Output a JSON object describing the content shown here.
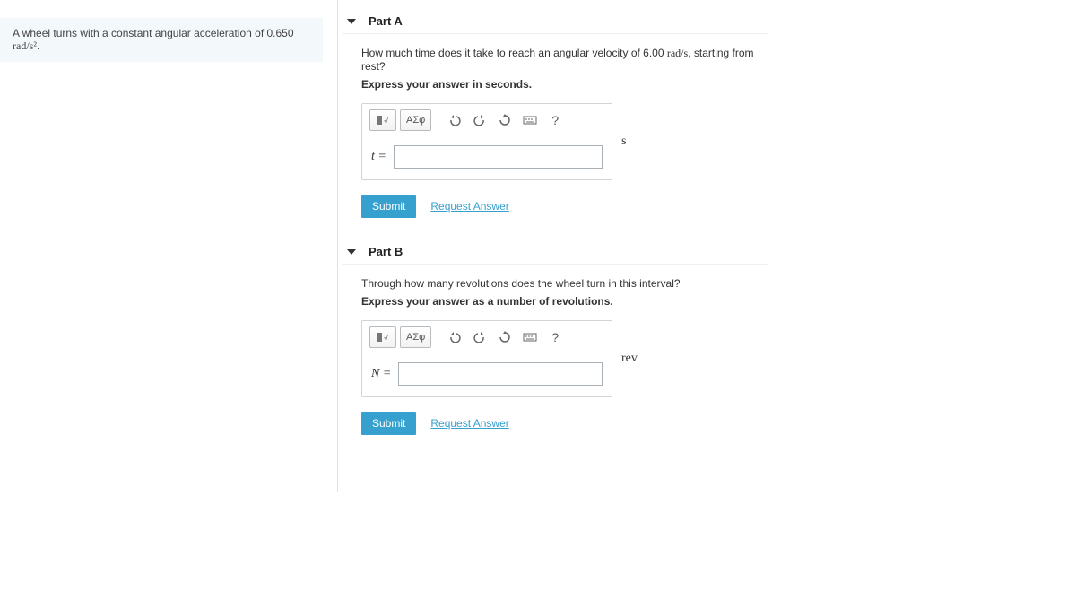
{
  "problem": {
    "text_pre": "A wheel turns with a constant angular acceleration of 0.650 ",
    "unit_html": "rad/s²",
    "text_post": "."
  },
  "parts": [
    {
      "title": "Part A",
      "question_pre": "How much time does it take to reach an angular velocity of 6.00 ",
      "question_unit": "rad/s",
      "question_post": ", starting from rest?",
      "instruction": "Express your answer in seconds.",
      "toolbar": {
        "symbols_label": "ΑΣφ"
      },
      "var": "t =",
      "unit": "s",
      "submit": "Submit",
      "request": "Request Answer"
    },
    {
      "title": "Part B",
      "question_pre": "Through how many revolutions does the wheel turn in this interval?",
      "question_unit": "",
      "question_post": "",
      "instruction": "Express your answer as a number of revolutions.",
      "toolbar": {
        "symbols_label": "ΑΣφ"
      },
      "var": "N =",
      "unit": "rev",
      "submit": "Submit",
      "request": "Request Answer"
    }
  ]
}
